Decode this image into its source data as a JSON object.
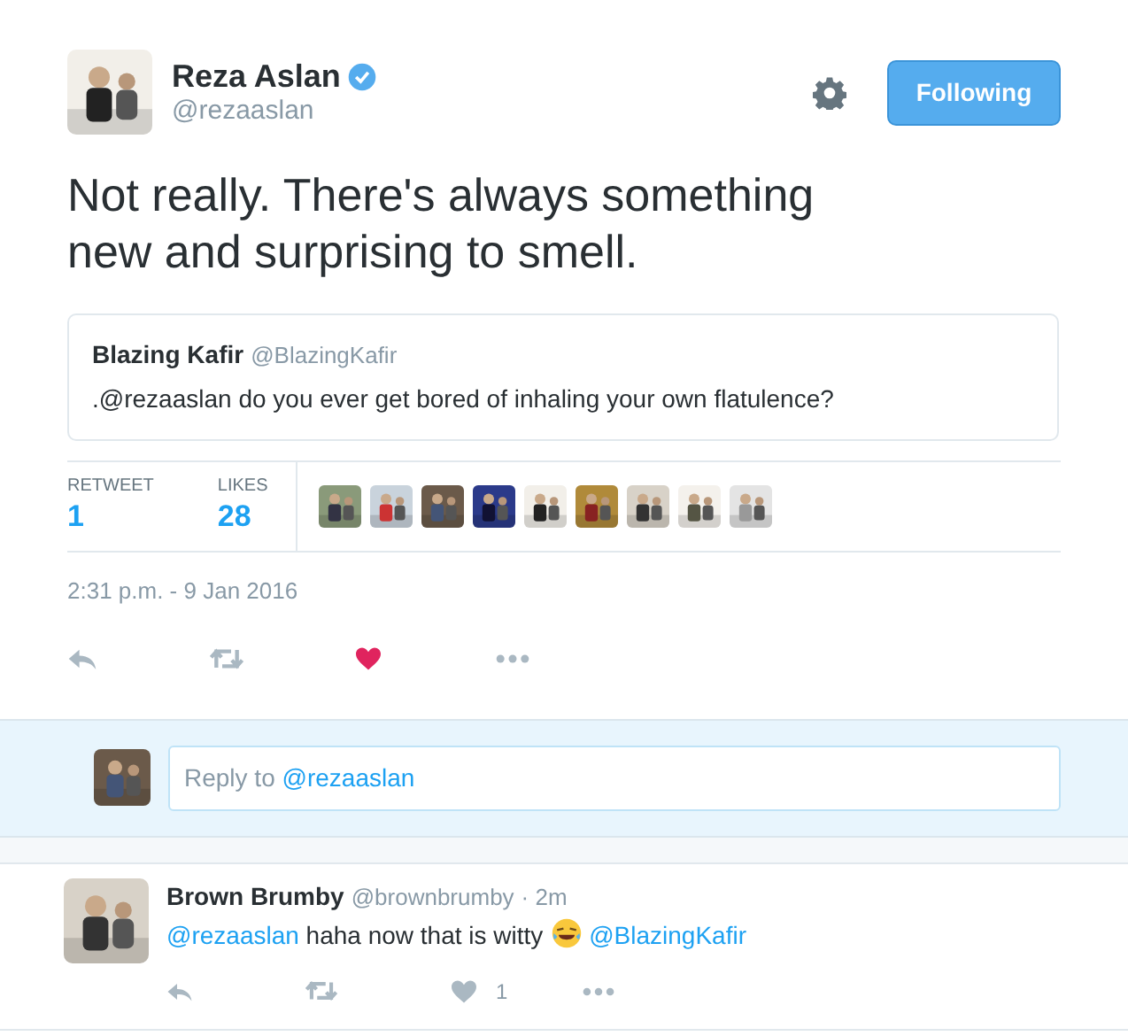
{
  "author": {
    "name": "Reza Aslan",
    "verified": true,
    "handle": "@rezaaslan"
  },
  "follow_button": {
    "label": "Following",
    "selected": true
  },
  "tweet_text": "Not really. There's always something new and surprising to smell.",
  "quoted_tweet": {
    "name": "Blazing Kafir",
    "handle": "@BlazingKafir",
    "text": ".@rezaaslan do you ever get bored of inhaling your own flatulence?"
  },
  "stats": [
    {
      "label": "RETWEET",
      "value": "1"
    },
    {
      "label": "LIKES",
      "value": "28"
    }
  ],
  "timestamp": "2:31 p.m. - 9 Jan 2016",
  "actions": {
    "liked": true
  },
  "reply_box": {
    "placeholder_parts": [
      {
        "kind": "text",
        "text": "Reply to "
      },
      {
        "kind": "mention",
        "text": "@rezaaslan"
      }
    ]
  },
  "replies": [
    {
      "name": "Brown Brumby",
      "handle": "@brownbrumby",
      "time": "· 2m",
      "parts": [
        {
          "kind": "mention",
          "text": "@rezaaslan"
        },
        {
          "kind": "text",
          "text": " haha now that is witty "
        },
        {
          "kind": "emoji"
        },
        {
          "kind": "space"
        },
        {
          "kind": "mention",
          "text": "@BlazingKafir"
        }
      ],
      "liked": false,
      "like_count": "1"
    }
  ]
}
